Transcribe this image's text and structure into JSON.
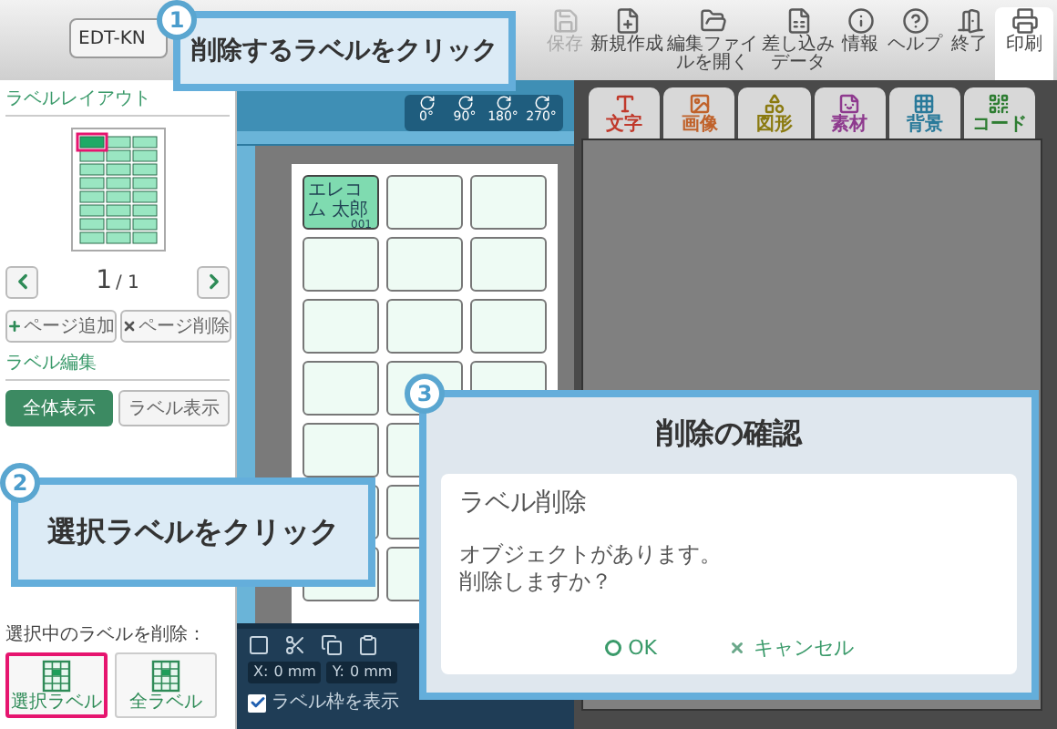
{
  "file_name": "EDT-KN",
  "toolbar": [
    {
      "kind": "save",
      "label": "保存",
      "disabled": true
    },
    {
      "kind": "new",
      "label": "新規作成",
      "disabled": false
    },
    {
      "kind": "open",
      "label": "編集ファイルを開く",
      "disabled": false
    },
    {
      "kind": "merge",
      "label": "差し込みデータ",
      "disabled": false
    },
    {
      "kind": "info",
      "label": "情報",
      "disabled": false
    },
    {
      "kind": "help",
      "label": "ヘルプ",
      "disabled": false
    },
    {
      "kind": "exit",
      "label": "終了",
      "disabled": false
    },
    {
      "kind": "print",
      "label": "印刷",
      "disabled": false
    }
  ],
  "sidebar": {
    "layout_title": "ラベルレイアウト",
    "pager": {
      "page": "1",
      "total": "/ 1"
    },
    "page_buttons": [
      {
        "kind": "add",
        "label": "ページ追加"
      },
      {
        "kind": "delete",
        "label": "ページ削除"
      }
    ],
    "edit_title": "ラベル編集",
    "view_buttons": [
      {
        "label": "全体表示",
        "selected": true
      },
      {
        "label": "ラベル表示",
        "selected": false
      }
    ],
    "delete_title": "選択中のラベルを削除：",
    "delete_buttons": [
      {
        "label": "選択ラベル",
        "highlighted": true
      },
      {
        "label": "全ラベル",
        "highlighted": false
      }
    ]
  },
  "canvas": {
    "rotations": [
      "0°",
      "90°",
      "180°",
      "270°"
    ],
    "first_label": {
      "name": "エレコム 太郎",
      "number": "001"
    },
    "coords": [
      {
        "axis": "X:",
        "value": "0 mm"
      },
      {
        "axis": "Y:",
        "value": "0 mm"
      }
    ],
    "show_frame": {
      "label": "ラベル枠を表示",
      "checked": true
    }
  },
  "object_tabs": [
    {
      "kind": "text",
      "label": "文字",
      "color": "#c0392b"
    },
    {
      "kind": "image",
      "label": "画像",
      "color": "#c0622b"
    },
    {
      "kind": "shape",
      "label": "図形",
      "color": "#8a7a10"
    },
    {
      "kind": "material",
      "label": "素材",
      "color": "#8e3a8e"
    },
    {
      "kind": "background",
      "label": "背景",
      "color": "#2a7a9a"
    },
    {
      "kind": "code",
      "label": "コード",
      "color": "#2e7d32"
    }
  ],
  "callouts": [
    {
      "number": "1",
      "text": "削除するラベルをクリック"
    },
    {
      "number": "2",
      "text": "選択ラベルをクリック"
    }
  ],
  "confirm": {
    "number": "3",
    "title": "削除の確認",
    "heading": "ラベル削除",
    "message": [
      "オブジェクトがあります。",
      "削除しますか？"
    ],
    "buttons": [
      {
        "kind": "ok",
        "label": "OK"
      },
      {
        "kind": "cancel",
        "label": "キャンセル"
      }
    ]
  }
}
